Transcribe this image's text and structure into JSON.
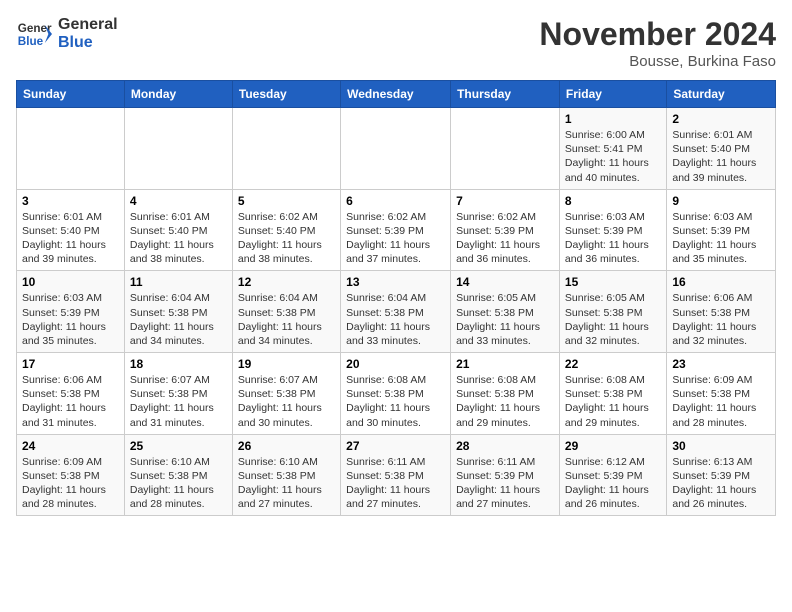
{
  "logo": {
    "line1": "General",
    "line2": "Blue"
  },
  "title": "November 2024",
  "subtitle": "Bousse, Burkina Faso",
  "days_header": [
    "Sunday",
    "Monday",
    "Tuesday",
    "Wednesday",
    "Thursday",
    "Friday",
    "Saturday"
  ],
  "weeks": [
    [
      {
        "day": "",
        "info": ""
      },
      {
        "day": "",
        "info": ""
      },
      {
        "day": "",
        "info": ""
      },
      {
        "day": "",
        "info": ""
      },
      {
        "day": "",
        "info": ""
      },
      {
        "day": "1",
        "info": "Sunrise: 6:00 AM\nSunset: 5:41 PM\nDaylight: 11 hours and 40 minutes."
      },
      {
        "day": "2",
        "info": "Sunrise: 6:01 AM\nSunset: 5:40 PM\nDaylight: 11 hours and 39 minutes."
      }
    ],
    [
      {
        "day": "3",
        "info": "Sunrise: 6:01 AM\nSunset: 5:40 PM\nDaylight: 11 hours and 39 minutes."
      },
      {
        "day": "4",
        "info": "Sunrise: 6:01 AM\nSunset: 5:40 PM\nDaylight: 11 hours and 38 minutes."
      },
      {
        "day": "5",
        "info": "Sunrise: 6:02 AM\nSunset: 5:40 PM\nDaylight: 11 hours and 38 minutes."
      },
      {
        "day": "6",
        "info": "Sunrise: 6:02 AM\nSunset: 5:39 PM\nDaylight: 11 hours and 37 minutes."
      },
      {
        "day": "7",
        "info": "Sunrise: 6:02 AM\nSunset: 5:39 PM\nDaylight: 11 hours and 36 minutes."
      },
      {
        "day": "8",
        "info": "Sunrise: 6:03 AM\nSunset: 5:39 PM\nDaylight: 11 hours and 36 minutes."
      },
      {
        "day": "9",
        "info": "Sunrise: 6:03 AM\nSunset: 5:39 PM\nDaylight: 11 hours and 35 minutes."
      }
    ],
    [
      {
        "day": "10",
        "info": "Sunrise: 6:03 AM\nSunset: 5:39 PM\nDaylight: 11 hours and 35 minutes."
      },
      {
        "day": "11",
        "info": "Sunrise: 6:04 AM\nSunset: 5:38 PM\nDaylight: 11 hours and 34 minutes."
      },
      {
        "day": "12",
        "info": "Sunrise: 6:04 AM\nSunset: 5:38 PM\nDaylight: 11 hours and 34 minutes."
      },
      {
        "day": "13",
        "info": "Sunrise: 6:04 AM\nSunset: 5:38 PM\nDaylight: 11 hours and 33 minutes."
      },
      {
        "day": "14",
        "info": "Sunrise: 6:05 AM\nSunset: 5:38 PM\nDaylight: 11 hours and 33 minutes."
      },
      {
        "day": "15",
        "info": "Sunrise: 6:05 AM\nSunset: 5:38 PM\nDaylight: 11 hours and 32 minutes."
      },
      {
        "day": "16",
        "info": "Sunrise: 6:06 AM\nSunset: 5:38 PM\nDaylight: 11 hours and 32 minutes."
      }
    ],
    [
      {
        "day": "17",
        "info": "Sunrise: 6:06 AM\nSunset: 5:38 PM\nDaylight: 11 hours and 31 minutes."
      },
      {
        "day": "18",
        "info": "Sunrise: 6:07 AM\nSunset: 5:38 PM\nDaylight: 11 hours and 31 minutes."
      },
      {
        "day": "19",
        "info": "Sunrise: 6:07 AM\nSunset: 5:38 PM\nDaylight: 11 hours and 30 minutes."
      },
      {
        "day": "20",
        "info": "Sunrise: 6:08 AM\nSunset: 5:38 PM\nDaylight: 11 hours and 30 minutes."
      },
      {
        "day": "21",
        "info": "Sunrise: 6:08 AM\nSunset: 5:38 PM\nDaylight: 11 hours and 29 minutes."
      },
      {
        "day": "22",
        "info": "Sunrise: 6:08 AM\nSunset: 5:38 PM\nDaylight: 11 hours and 29 minutes."
      },
      {
        "day": "23",
        "info": "Sunrise: 6:09 AM\nSunset: 5:38 PM\nDaylight: 11 hours and 28 minutes."
      }
    ],
    [
      {
        "day": "24",
        "info": "Sunrise: 6:09 AM\nSunset: 5:38 PM\nDaylight: 11 hours and 28 minutes."
      },
      {
        "day": "25",
        "info": "Sunrise: 6:10 AM\nSunset: 5:38 PM\nDaylight: 11 hours and 28 minutes."
      },
      {
        "day": "26",
        "info": "Sunrise: 6:10 AM\nSunset: 5:38 PM\nDaylight: 11 hours and 27 minutes."
      },
      {
        "day": "27",
        "info": "Sunrise: 6:11 AM\nSunset: 5:38 PM\nDaylight: 11 hours and 27 minutes."
      },
      {
        "day": "28",
        "info": "Sunrise: 6:11 AM\nSunset: 5:39 PM\nDaylight: 11 hours and 27 minutes."
      },
      {
        "day": "29",
        "info": "Sunrise: 6:12 AM\nSunset: 5:39 PM\nDaylight: 11 hours and 26 minutes."
      },
      {
        "day": "30",
        "info": "Sunrise: 6:13 AM\nSunset: 5:39 PM\nDaylight: 11 hours and 26 minutes."
      }
    ]
  ]
}
